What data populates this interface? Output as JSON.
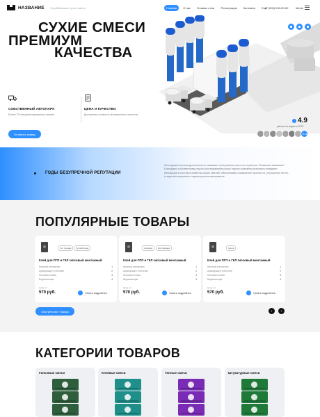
{
  "header": {
    "brand": "НАЗВАНИЕ",
    "brand_sub": "Стройбазовые сухие смеси",
    "nav": [
      "Главная",
      "О нас",
      "Отзывы о нас",
      "Регистрация",
      "Контакты",
      "Ещё"
    ],
    "active_nav": "Главная",
    "phone": "+7 (000) 000-00-00",
    "menu_label": "Меню"
  },
  "hero": {
    "title_line1": "СУХИЕ СМЕСИ",
    "title_line2": "ПРЕМИУМ",
    "title_line3": "КАЧЕСТВА",
    "features": [
      {
        "icon": "truck-icon",
        "title": "СОБСТВЕННЫЙ АВТОПАРК",
        "desc": "Более 70 специализированных машин"
      },
      {
        "icon": "document-icon",
        "title": "ЦЕНА И КАЧЕСТВО",
        "desc": "Доступная стоимость материалов и качество"
      }
    ],
    "cta": "Оставить заявку",
    "rating": "4.9",
    "rating_sub": "рейтинг на яндекс и 2ГИС",
    "avatars_more": "+12к",
    "socials": [
      "vk-icon",
      "telegram-icon",
      "whatsapp-icon"
    ]
  },
  "band": {
    "title": "ГОДЫ БЕЗУПРЕЧНОЙ РЕПУТАЦИИ",
    "text": "Исследовательская деятельность занимает центральное место в стратегии \"Название компании\". Благодаря собственному научно-исследовательскому отделу компания регулярно внедряет инновации в состав и свойства своих смесей, обеспечивая повышение прочности, улучшение тепло- и звукоизоляционных характеристик материалов."
  },
  "popular": {
    "title": "ПОПУЛЯРНЫЕ ТОВАРЫ",
    "products": [
      {
        "tags": [
          "Хит продаж",
          "Лучший цена"
        ],
        "name": "Клей для ПГП и ГКЛ гипсовый монтажный",
        "specs": [
          {
            "k": "Налитый утеплитель",
            "v": "1"
          },
          {
            "k": "Армирующее утепление",
            "v": "2"
          },
          {
            "k": "Гипсовая основа",
            "v": "3"
          },
          {
            "k": "Водоизоляция",
            "v": "4"
          }
        ],
        "price_label": "Цена шт.",
        "price": "570 руб.",
        "more": "Узнать подробнее"
      },
      {
        "tags": [
          "Новинка",
          "Для фасада"
        ],
        "name": "Клей для ПГП и ГКЛ гипсовый монтажный",
        "specs": [
          {
            "k": "Налитый утеплитель",
            "v": "1"
          },
          {
            "k": "Армирующее утепление",
            "v": "2"
          },
          {
            "k": "Гипсовая основа",
            "v": "3"
          },
          {
            "k": "Водоизоляция",
            "v": "4"
          }
        ],
        "price_label": "Цена шт.",
        "price": "570 руб.",
        "more": "Узнать подробнее"
      },
      {
        "tags": [
          "Акция"
        ],
        "name": "Клей для ПГП и ГКЛ гипсовый монтажный",
        "specs": [
          {
            "k": "Налитый утеплитель",
            "v": "1"
          },
          {
            "k": "Армирующее утепление",
            "v": "2"
          },
          {
            "k": "Гипсовая основа",
            "v": "3"
          },
          {
            "k": "Водоизоляция",
            "v": "4"
          }
        ],
        "price_label": "Цена шт.",
        "price": "570 руб.",
        "more": "Узнать подробнее"
      }
    ],
    "all_button": "Смотреть все товары"
  },
  "categories": {
    "title": "КАТЕГОРИИ ТОВАРОВ",
    "items": [
      {
        "name": "Гипсовые смеси",
        "color": "#2e5e3c"
      },
      {
        "name": "Клеевые смеси",
        "color": "#1f8f8a"
      },
      {
        "name": "Теплые смеси",
        "color": "#7a2bb5"
      },
      {
        "name": "Штукатурные смеси",
        "color": "#1f7a3a"
      }
    ]
  },
  "colors": {
    "accent": "#2f8fff",
    "dark": "#111111"
  }
}
